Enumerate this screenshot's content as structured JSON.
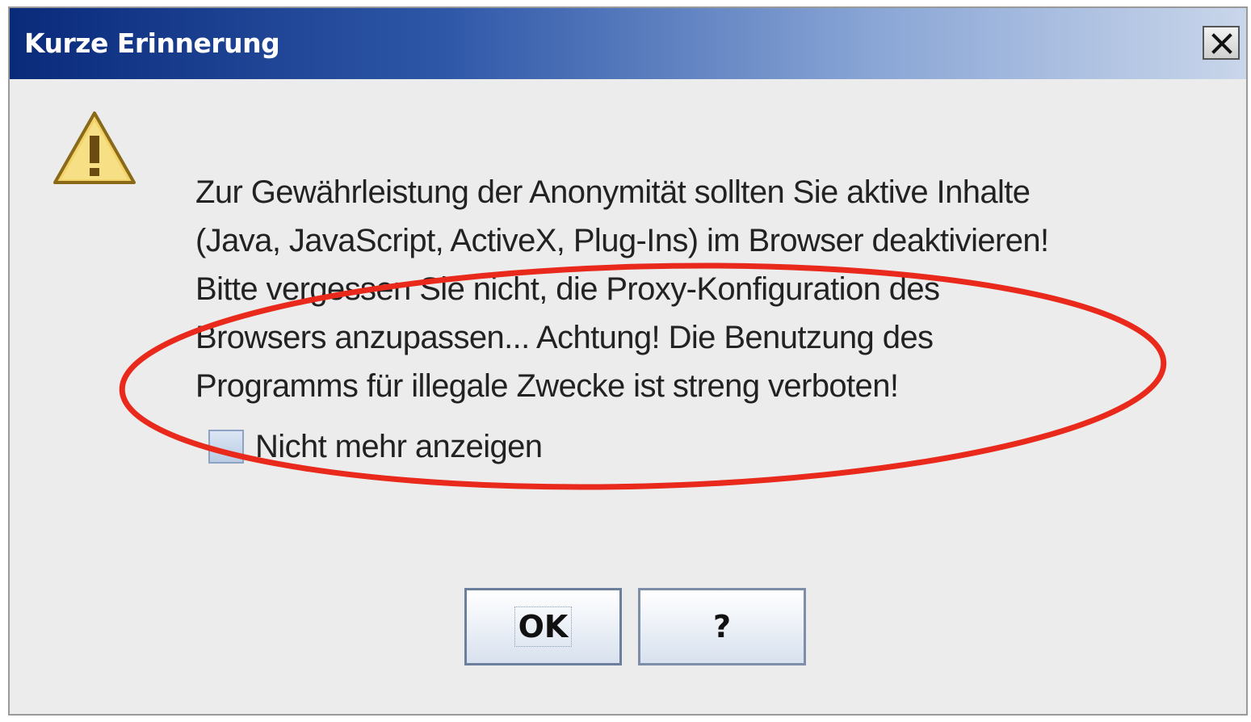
{
  "dialog": {
    "title": "Kurze Erinnerung",
    "close_label": "close"
  },
  "message": {
    "lines": [
      "Zur Gewährleistung der Anonymität sollten Sie aktive Inhalte",
      "(Java, JavaScript, ActiveX, Plug-Ins) im Browser deaktivieren!",
      "Bitte vergessen Sie nicht, die Proxy-Konfiguration des",
      "Browsers anzupassen... Achtung! Die Benutzung des",
      "Programms für illegale Zwecke ist streng verboten!"
    ]
  },
  "checkbox": {
    "label": "Nicht mehr anzeigen",
    "checked": false
  },
  "buttons": {
    "ok_label": "OK",
    "help_label": "?"
  },
  "icons": {
    "warning": "warning-icon",
    "close": "close-icon"
  },
  "colors": {
    "titlebar_start": "#0a2a7a",
    "titlebar_end": "#c9d6ea",
    "annotation": "#e8291b",
    "warning_fill": "#f2d36a"
  }
}
